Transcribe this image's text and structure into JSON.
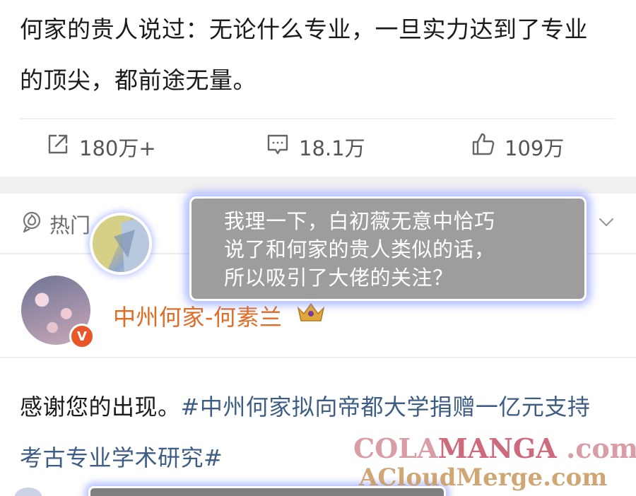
{
  "post": {
    "text_line1": "何家的贵人说过：无论什么专业，一旦实力达到了专业",
    "text_line2": "的顶尖，都前途无量。"
  },
  "actions": {
    "share_count": "180万+",
    "comment_count": "18.1万",
    "like_count": "109万"
  },
  "hot_tab": {
    "label": "热门"
  },
  "comment": {
    "author_name": "中州何家-何素兰",
    "text_plain": "感谢您的出现。",
    "hashtag_line1": "#中州何家拟向帝都大学捐赠一亿元支持",
    "hashtag_line2": "考古专业学术研究#"
  },
  "bubble": {
    "line1": "我理一下，白初薇无意中恰巧",
    "line2": "说了和何家的贵人类似的话，",
    "line3": "所以吸引了大佬的关注？"
  },
  "watermark": {
    "part1": "COLA",
    "part2": "MANGA",
    "part3": " .com",
    "line2": "ACloudMerge.com"
  },
  "colors": {
    "author_name": "#e06b24",
    "hashtag": "#3e5d84",
    "bubble_bg": "#969696",
    "bubble_glow": "#788cff"
  },
  "icons": {
    "share": "share-icon",
    "comment": "comment-icon",
    "like": "thumbs-up-icon",
    "hot": "hot-icon",
    "chevron": "chevron-down-icon",
    "verified": "verified-badge",
    "crown": "crown-badge-icon"
  }
}
